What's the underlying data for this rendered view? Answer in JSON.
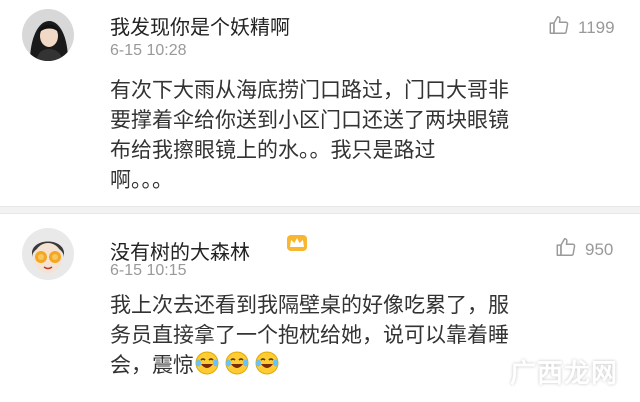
{
  "comments": [
    {
      "username": "我发现你是个妖精啊",
      "time": "6-15 10:28",
      "likes": "1199",
      "lines": [
        "有次下大雨从海底捞门口路过，门口大哥非",
        "要撑着伞给你送到小区门口还送了两块眼镜",
        "布给我擦眼镜上的水。。我只是路过",
        "啊。。。"
      ]
    },
    {
      "username": "没有树的大森林",
      "time": "6-15 10:15",
      "likes": "950",
      "lines": [
        "我上次去还看到我隔壁桌的好像吃累了，服",
        "务员直接拿了一个抱枕给她，说可以靠着睡",
        "会，震惊"
      ],
      "emoji_count": 3
    }
  ],
  "watermark": "广西龙网",
  "icons": {
    "like": "thumbs-up-icon",
    "badge": "crown-badge-icon",
    "emoji": "laughing-tears-emoji"
  },
  "colors": {
    "username": "#222222",
    "meta": "#999999",
    "text": "#333333",
    "divider": "#f2f2f2"
  }
}
